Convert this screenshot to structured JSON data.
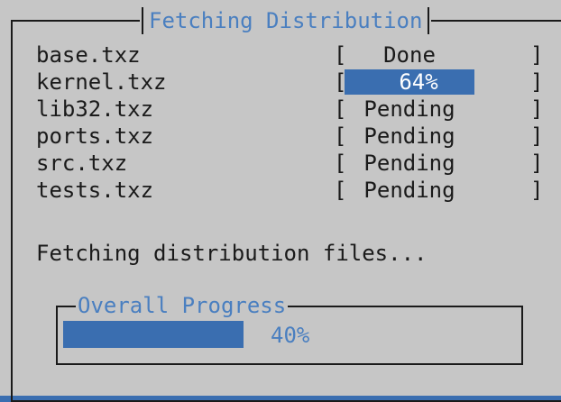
{
  "dialog": {
    "title": "Fetching Distribution",
    "files": [
      {
        "name": "base.txz",
        "status": "Done",
        "active": false
      },
      {
        "name": "kernel.txz",
        "status": "64%",
        "active": true,
        "progress": 0.64
      },
      {
        "name": "lib32.txz",
        "status": "Pending",
        "active": false
      },
      {
        "name": "ports.txz",
        "status": "Pending",
        "active": false
      },
      {
        "name": "src.txz",
        "status": "Pending",
        "active": false
      },
      {
        "name": "tests.txz",
        "status": "Pending",
        "active": false
      }
    ],
    "bracket_open": "[",
    "bracket_close": "]",
    "message": "Fetching distribution files...",
    "overall": {
      "title": "Overall Progress",
      "percent_text": "40%",
      "progress": 0.4
    }
  },
  "colors": {
    "background": "#3a6eb0",
    "panel": "#c6c6c6",
    "accent": "#3a6eb0",
    "title_text": "#4a7fc0",
    "border": "#1a1a1a"
  }
}
